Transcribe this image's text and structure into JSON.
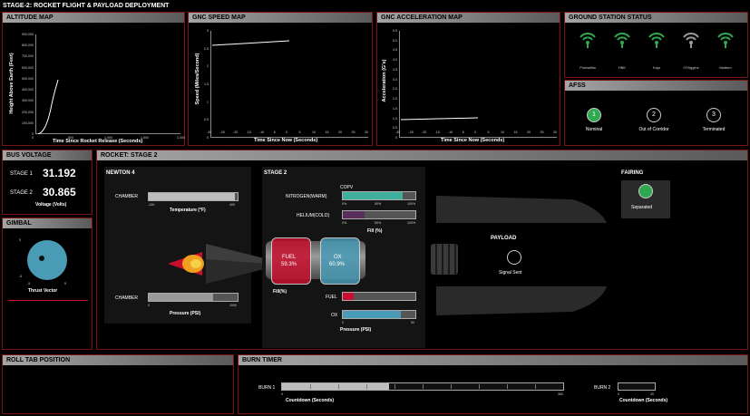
{
  "page_title": "STAGE-2: ROCKET FLIGHT & PAYLOAD DEPLOYMENT",
  "altitude": {
    "title": "ALTITUDE MAP",
    "ylabel": "Height Above Earth (Feet)",
    "xlabel": "Time Since Rocket Release (Seconds)",
    "yticks": [
      "900,000",
      "800,000",
      "700,000",
      "600,000",
      "500,000",
      "400,000",
      "300,000",
      "200,000",
      "100,000",
      "0"
    ],
    "xticks": [
      "0",
      "500",
      "1,000",
      "1,500",
      "2,000"
    ]
  },
  "speed": {
    "title": "GNC SPEED MAP",
    "ylabel": "Speed (Miles/Second)",
    "xlabel": "Time Since Now (Seconds)",
    "yticks": [
      "3",
      "2.5",
      "2",
      "1.5",
      "1",
      "0.5",
      "0"
    ],
    "xticks": [
      "-30",
      "-25",
      "-20",
      "-15",
      "-10",
      "-5",
      "0",
      "5",
      "10",
      "15",
      "20",
      "25",
      "30"
    ]
  },
  "accel": {
    "title": "GNC ACCELERATION MAP",
    "ylabel": "Acceleration (G's)",
    "xlabel": "Time Since Now (Seconds)",
    "yticks": [
      "5.5",
      "5.0",
      "4.5",
      "4.0",
      "3.5",
      "3.0",
      "2.5",
      "2.0",
      "1.5",
      "1.0",
      "0.5",
      "0"
    ],
    "xticks": [
      "-30",
      "-25",
      "-20",
      "-15",
      "-10",
      "-5",
      "0",
      "5",
      "10",
      "15",
      "20",
      "25",
      "30"
    ]
  },
  "ground": {
    "title": "GROUND STATION STATUS",
    "stations": [
      {
        "name": "Poinsettia",
        "color": "#2fa84f"
      },
      {
        "name": "HBK",
        "color": "#2fa84f"
      },
      {
        "name": "Kaju",
        "color": "#2fa84f"
      },
      {
        "name": "O'Higgins",
        "color": "#9a9a9a"
      },
      {
        "name": "Mattern",
        "color": "#2fa84f"
      }
    ]
  },
  "afss": {
    "title": "AFSS",
    "items": [
      {
        "num": "1",
        "label": "Nominal"
      },
      {
        "num": "2",
        "label": "Out of Corridor"
      },
      {
        "num": "3",
        "label": "Terminated"
      }
    ]
  },
  "bus": {
    "title": "BUS VOLTAGE",
    "stage1_label": "STAGE 1",
    "stage1_value": "31.192",
    "stage2_label": "STAGE 2",
    "stage2_value": "30.865",
    "unit": "Voltage (Volts)"
  },
  "gimbal": {
    "title": "GIMBAL",
    "label": "Thrust Vector",
    "ticks": [
      "5",
      "-5",
      "-5",
      "5"
    ]
  },
  "rocket": {
    "title": "ROCKET: STAGE 2",
    "newton_title": "NEWTON 4",
    "chamber_label": "CHAMBER",
    "temp_label": "Temperature (°F)",
    "temp_min": "-100",
    "temp_max": "400",
    "temp_fill": 0.97,
    "chamber2_label": "CHAMBER",
    "pressure_label": "Pressure (PSI)",
    "pressure_min": "0",
    "pressure_max": "1000",
    "pressure_fill": 0.72,
    "stage2_title": "STAGE 2",
    "copv_label": "COPV",
    "nitrogen_label": "NITROGEN(WARM)",
    "nitrogen_fill": 0.82,
    "helium_label": "HELIUM(COLD)",
    "helium_fill": 0.3,
    "copv_ticks": [
      "0%",
      "50%",
      "100%"
    ],
    "fill_pct_label": "Fill (%)",
    "fuel_tank_label": "FUEL",
    "fuel_tank_value": "59.3%",
    "ox_tank_label": "OX",
    "ox_tank_value": "60.9%",
    "tank_fill_label": "Fill(%)",
    "fuel_label": "FUEL",
    "fuel_fill": 0.15,
    "ox_label": "OX",
    "ox_fill": 0.8,
    "press_ticks": [
      "0",
      "90"
    ],
    "press_label": "Pressure (PSI)",
    "payload_title": "PAYLOAD",
    "payload_status": "Signal Sent",
    "fairing_title": "FAIRING",
    "fairing_status": "Separated"
  },
  "roll": {
    "title": "ROLL TAB POSITION"
  },
  "burn": {
    "title": "BURN TIMER",
    "burn1_label": "BURN 1",
    "burn1_fill": 0.38,
    "burn1_min": "0",
    "burn1_max": "360",
    "burn1_unit": "Countdown (Seconds)",
    "burn2_label": "BURN 2",
    "burn2_min": "0",
    "burn2_max": "20",
    "burn2_unit": "Countdown (Seconds)"
  },
  "colors": {
    "green": "#2fa84f",
    "teal": "#3fae9a",
    "purple": "#5a2e5a",
    "red": "#c8102e",
    "blue": "#4a9bb5",
    "border": "#7a1414"
  }
}
